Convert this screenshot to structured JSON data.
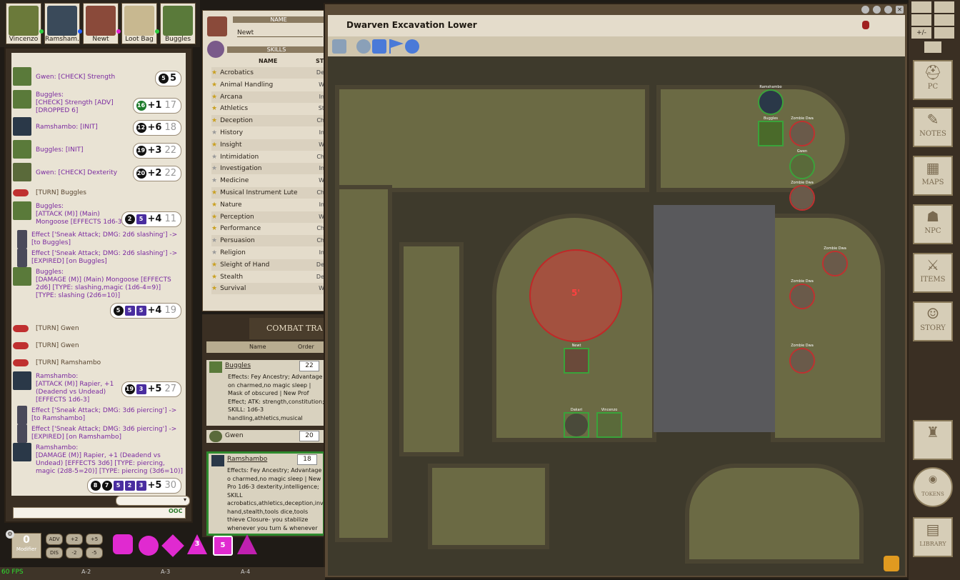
{
  "portraits": [
    {
      "label": "Vincenzo",
      "color": "#6b7a3a",
      "dot": "#2ecc40"
    },
    {
      "label": "Ramsham...",
      "color": "#3a4a5a",
      "dot": "#1e5aff"
    },
    {
      "label": "Newt",
      "color": "#8a4a3a",
      "dot": "#e020d0"
    },
    {
      "label": "Loot Bag",
      "color": "#c8b890",
      "dot": "#2ecc40"
    },
    {
      "label": "Buggles",
      "color": "#5a7a3a",
      "dot": ""
    }
  ],
  "chat": {
    "messages": [
      {
        "text": "Gwen:  [CHECK] Strength",
        "roll": "5",
        "dice": [
          "5"
        ]
      },
      {
        "text": "Buggles:\n[CHECK] Strength [ADV]\n[DROPPED 6]",
        "roll": "+1",
        "total": "17",
        "dice": [
          "16"
        ]
      },
      {
        "text": "Ramshambo:  [INIT]",
        "roll": "+6",
        "total": "18",
        "dice": [
          "12"
        ]
      },
      {
        "text": "Buggles:  [INIT]",
        "roll": "+3",
        "total": "22",
        "dice": [
          "19"
        ]
      },
      {
        "text": "Gwen:  [CHECK] Dexterity",
        "roll": "+2",
        "total": "22",
        "dice": [
          "20"
        ]
      },
      {
        "text": "[TURN] Buggles"
      },
      {
        "text": "Buggles:\n[ATTACK (M)] (Main)\nMongoose [EFFECTS 1d6-3]",
        "roll": "+4",
        "total": "11",
        "dice": [
          "2",
          "5"
        ]
      },
      {
        "text": "Effect ['Sneak Attack; DMG: 2d6 slashing'] -> [to Buggles]"
      },
      {
        "text": "Effect ['Sneak Attack; DMG: 2d6 slashing'] -> [EXPIRED] [on Buggles]"
      },
      {
        "text": "Buggles:\n[DAMAGE (M)] (Main) Mongoose [EFFECTS 2d6] [TYPE: slashing,magic (1d6-4=9)] [TYPE: slashing (2d6=10)]"
      },
      {
        "text": "",
        "roll": "+4",
        "total": "19",
        "dice": [
          "5",
          "5",
          "5"
        ]
      },
      {
        "text": "[TURN] Gwen"
      },
      {
        "text": "[TURN] Gwen"
      },
      {
        "text": "[TURN] Ramshambo"
      },
      {
        "text": "Ramshambo:\n[ATTACK (M)] Rapier, +1 (Deadend vs Undead) [EFFECTS 1d6-3]",
        "roll": "+5",
        "total": "27",
        "dice": [
          "19",
          "3"
        ]
      },
      {
        "text": "Effect ['Sneak Attack; DMG: 3d6 piercing'] -> [to Ramshambo]"
      },
      {
        "text": "Effect ['Sneak Attack; DMG: 3d6 piercing'] -> [EXPIRED] [on Ramshambo]"
      },
      {
        "text": "Ramshambo:\n[DAMAGE (M)] Rapier, +1 (Deadend vs Undead) [EFFECTS 3d6] [TYPE: piercing, magic (2d8-5=20)] [TYPE: piercing (3d6=10)]"
      },
      {
        "text": "",
        "roll": "+5",
        "total": "30",
        "dice": [
          "8",
          "7",
          "5",
          "2",
          "3"
        ]
      }
    ],
    "ooc": "OOC"
  },
  "sheet": {
    "name_header": "NAME",
    "name": "Newt",
    "skills_header": "SKILLS",
    "col_name": "NAME",
    "col_stat": "ST",
    "skills": [
      {
        "name": "Acrobatics",
        "code": "De",
        "prof": true
      },
      {
        "name": "Animal Handling",
        "code": "W",
        "prof": true
      },
      {
        "name": "Arcana",
        "code": "In",
        "prof": true
      },
      {
        "name": "Athletics",
        "code": "St",
        "prof": true
      },
      {
        "name": "Deception",
        "code": "Ch",
        "prof": true
      },
      {
        "name": "History",
        "code": "In",
        "prof": false
      },
      {
        "name": "Insight",
        "code": "W",
        "prof": true
      },
      {
        "name": "Intimidation",
        "code": "Ch",
        "prof": false
      },
      {
        "name": "Investigation",
        "code": "In",
        "prof": false
      },
      {
        "name": "Medicine",
        "code": "W",
        "prof": false
      },
      {
        "name": "Musical Instrument Lute",
        "code": "Ch",
        "prof": true
      },
      {
        "name": "Nature",
        "code": "In",
        "prof": true
      },
      {
        "name": "Perception",
        "code": "W",
        "prof": true
      },
      {
        "name": "Performance",
        "code": "Ch",
        "prof": true
      },
      {
        "name": "Persuasion",
        "code": "Ch",
        "prof": false
      },
      {
        "name": "Religion",
        "code": "In",
        "prof": false
      },
      {
        "name": "Sleight of Hand",
        "code": "De",
        "prof": true
      },
      {
        "name": "Stealth",
        "code": "De",
        "prof": true
      },
      {
        "name": "Survival",
        "code": "W",
        "prof": true
      }
    ]
  },
  "combat": {
    "title": "COMBAT TRA",
    "col_name": "Name",
    "col_order": "Order",
    "entries": [
      {
        "name": "Buggles",
        "init": "22",
        "desc": "Effects: Fey Ancestry; Advantage on charmed,no magic sleep | Mask of obscured | New Prof Effect; ATK: strength,constitution; SKILL: 1d6-3 handling,athletics,musical instrume flute,perception,stealth,survival,to"
      },
      {
        "name": "Gwen",
        "init": "20",
        "desc": ""
      },
      {
        "name": "Ramshambo",
        "init": "18",
        "desc": "Effects: Fey Ancestry; Advantage o charmed,no magic sleep | New Pro 1d6-3 dexterity,intelligence; SKILL acrobatics,athletics,deception,inve hand,stealth,tools dice,tools thieve Closure- you stabilize whenever you turn & whenever you roll a Hit Die number of hit points it restores."
      }
    ]
  },
  "map": {
    "title": "Dwarven Excavation Lower",
    "range_label": "5'",
    "tokens": [
      {
        "label": "Ramshambo",
        "color": "#2a3848"
      },
      {
        "label": "Buggles",
        "color": "#4a6a2a"
      },
      {
        "label": "Zombie Dwa",
        "color": "#6a5a4a"
      },
      {
        "label": "Gwen",
        "color": "#5a6a3a"
      },
      {
        "label": "Zombie Dwa",
        "color": "#6a5a4a"
      },
      {
        "label": "Zombie Dwa",
        "color": "#6a5a4a"
      },
      {
        "label": "Zombie Dwa",
        "color": "#6a5a4a"
      },
      {
        "label": "Zombie Dwa",
        "color": "#6a5a4a"
      },
      {
        "label": "Newt",
        "color": "#6a4a3a"
      },
      {
        "label": "Dakari",
        "color": "#4a4a3a"
      },
      {
        "label": "Vincenzo",
        "color": "#5a6a3a"
      }
    ]
  },
  "sidebar": {
    "buttons": [
      "PC",
      "NOTES",
      "MAPS",
      "NPC",
      "ITEMS",
      "STORY",
      "TOKENS",
      "LIBRARY"
    ],
    "top_plusminus": "+/-"
  },
  "bottom": {
    "fps": "60 FPS",
    "grid": [
      "A-2",
      "A-3",
      "A-4"
    ],
    "modifier_value": "0",
    "modifier_label": "Modifier",
    "mod_buttons": [
      "ADV",
      "+2",
      "+5",
      "DIS",
      "-2",
      "-5"
    ],
    "dice": [
      "",
      "",
      "",
      "3",
      "5",
      ""
    ]
  }
}
